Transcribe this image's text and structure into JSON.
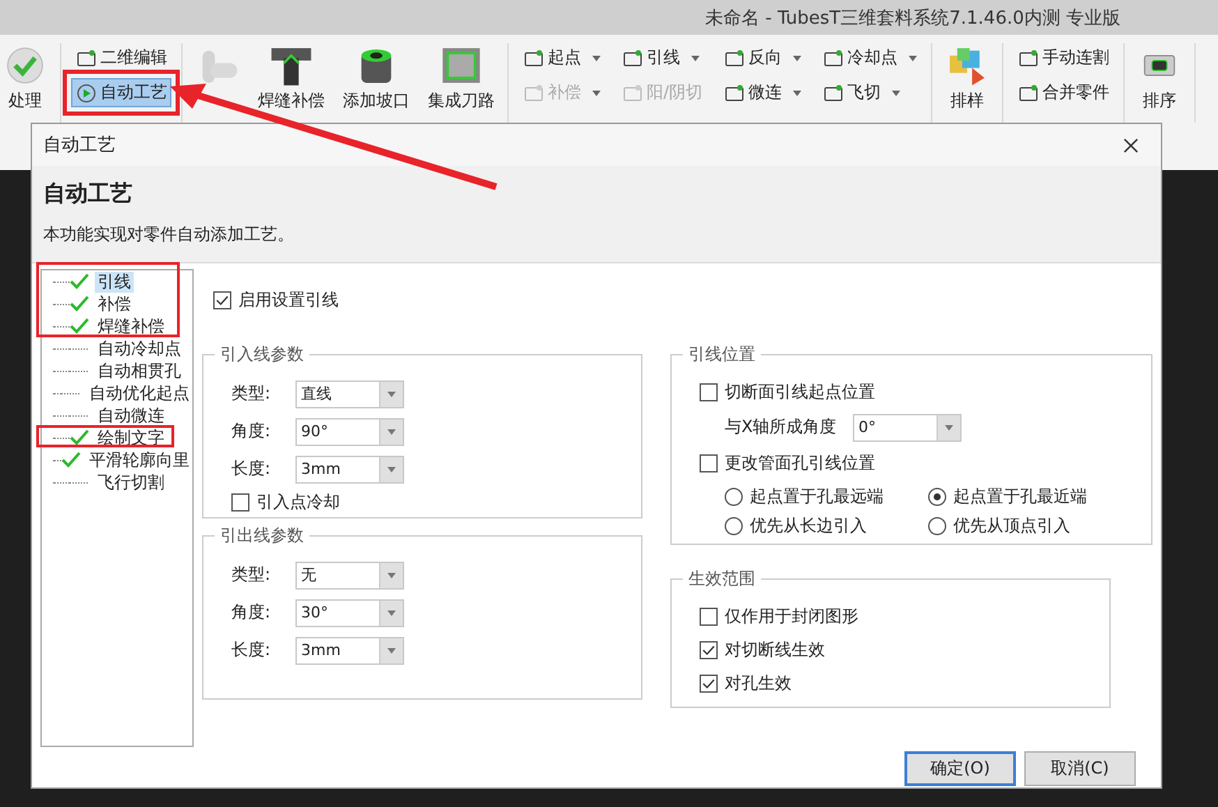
{
  "title_bar": {
    "title": "未命名 - TubesT三维套料系统7.1.46.0内测  专业版"
  },
  "ribbon": {
    "groups": [
      {
        "columns": [
          {
            "kind": "large",
            "items": [
              {
                "label": "处理",
                "disabled": false
              }
            ]
          }
        ]
      },
      {
        "columns": [
          {
            "kind": "stack",
            "items": [
              {
                "label": "二维编辑",
                "disabled": false,
                "selected": false,
                "dropdown": false
              },
              {
                "label": "自动工艺",
                "disabled": false,
                "selected": true,
                "dropdown": false
              }
            ]
          }
        ]
      },
      {
        "columns": [
          {
            "kind": "large",
            "items": [
              {
                "disabled": true
              }
            ]
          },
          {
            "kind": "large",
            "items": [
              {
                "label": "焊缝补偿",
                "disabled": false
              }
            ]
          },
          {
            "kind": "large",
            "items": [
              {
                "label": "添加坡口",
                "disabled": false
              }
            ]
          },
          {
            "kind": "large",
            "items": [
              {
                "label": "集成刀路",
                "disabled": false
              }
            ]
          }
        ]
      },
      {
        "columns": [
          {
            "kind": "stack",
            "items": [
              {
                "label": "起点",
                "disabled": false,
                "selected": false,
                "dropdown": true
              },
              {
                "label": "补偿",
                "disabled": true,
                "selected": false,
                "dropdown": true
              }
            ]
          },
          {
            "kind": "stack",
            "items": [
              {
                "label": "引线",
                "disabled": false,
                "selected": false,
                "dropdown": true
              },
              {
                "label": "阳/阴切",
                "disabled": true,
                "selected": false,
                "dropdown": false
              }
            ]
          },
          {
            "kind": "stack",
            "items": [
              {
                "label": "反向",
                "disabled": false,
                "selected": false,
                "dropdown": true
              },
              {
                "label": "微连",
                "disabled": false,
                "selected": false,
                "dropdown": true
              }
            ]
          },
          {
            "kind": "stack",
            "items": [
              {
                "label": "冷却点",
                "disabled": false,
                "selected": false,
                "dropdown": true
              },
              {
                "label": "飞切",
                "disabled": false,
                "selected": false,
                "dropdown": true
              }
            ]
          }
        ]
      },
      {
        "columns": [
          {
            "kind": "large",
            "items": [
              {
                "label": "排样",
                "disabled": false
              }
            ]
          }
        ]
      },
      {
        "columns": [
          {
            "kind": "stack",
            "items": [
              {
                "label": "手动连割",
                "disabled": false,
                "selected": false,
                "dropdown": false
              },
              {
                "label": "合并零件",
                "disabled": false,
                "selected": false,
                "dropdown": false
              }
            ]
          }
        ]
      },
      {
        "columns": [
          {
            "kind": "large",
            "items": [
              {
                "label": "排序",
                "disabled": false
              }
            ]
          }
        ]
      }
    ]
  },
  "dialog": {
    "title": "自动工艺",
    "heading": "自动工艺",
    "description": "本功能实现对零件自动添加工艺。",
    "tree": [
      {
        "label": "引线",
        "checked": true,
        "selected": true
      },
      {
        "label": "补偿",
        "checked": true,
        "selected": false
      },
      {
        "label": "焊缝补偿",
        "checked": true,
        "selected": false
      },
      {
        "label": "自动冷却点",
        "checked": false,
        "selected": false
      },
      {
        "label": "自动相贯孔",
        "checked": false,
        "selected": false
      },
      {
        "label": "自动优化起点",
        "checked": false,
        "selected": false
      },
      {
        "label": "自动微连",
        "checked": false,
        "selected": false
      },
      {
        "label": "绘制文字",
        "checked": true,
        "selected": false
      },
      {
        "label": "平滑轮廓向里",
        "checked": true,
        "selected": false
      },
      {
        "label": "飞行切割",
        "checked": false,
        "selected": false
      }
    ],
    "enable_lead": {
      "label": "启用设置引线",
      "checked": true
    },
    "lead_in": {
      "title": "引入线参数",
      "fields": [
        {
          "label": "类型:",
          "value": "直线"
        },
        {
          "label": "角度:",
          "value": "90°"
        },
        {
          "label": "长度:",
          "value": "3mm"
        }
      ],
      "cooling": {
        "label": "引入点冷却",
        "checked": false
      }
    },
    "lead_out": {
      "title": "引出线参数",
      "fields": [
        {
          "label": "类型:",
          "value": "无"
        },
        {
          "label": "角度:",
          "value": "30°"
        },
        {
          "label": "长度:",
          "value": "3mm"
        }
      ]
    },
    "lead_position": {
      "title": "引线位置",
      "cut_start": {
        "label": "切断面引线起点位置",
        "checked": false
      },
      "angle": {
        "label": "与X轴所成角度",
        "value": "0°"
      },
      "change_hole": {
        "label": "更改管面孔引线位置",
        "checked": false
      },
      "radios": [
        {
          "label": "起点置于孔最远端",
          "selected": false
        },
        {
          "label": "起点置于孔最近端",
          "selected": true
        },
        {
          "label": "优先从长边引入",
          "selected": false
        },
        {
          "label": "优先从顶点引入",
          "selected": false
        }
      ]
    },
    "scope": {
      "title": "生效范围",
      "options": [
        {
          "label": "仅作用于封闭图形",
          "checked": false
        },
        {
          "label": "对切断线生效",
          "checked": true
        },
        {
          "label": "对孔生效",
          "checked": true
        }
      ]
    },
    "buttons": [
      {
        "label": "确定(O)",
        "default": true
      },
      {
        "label": "取消(C)",
        "default": false
      }
    ]
  }
}
